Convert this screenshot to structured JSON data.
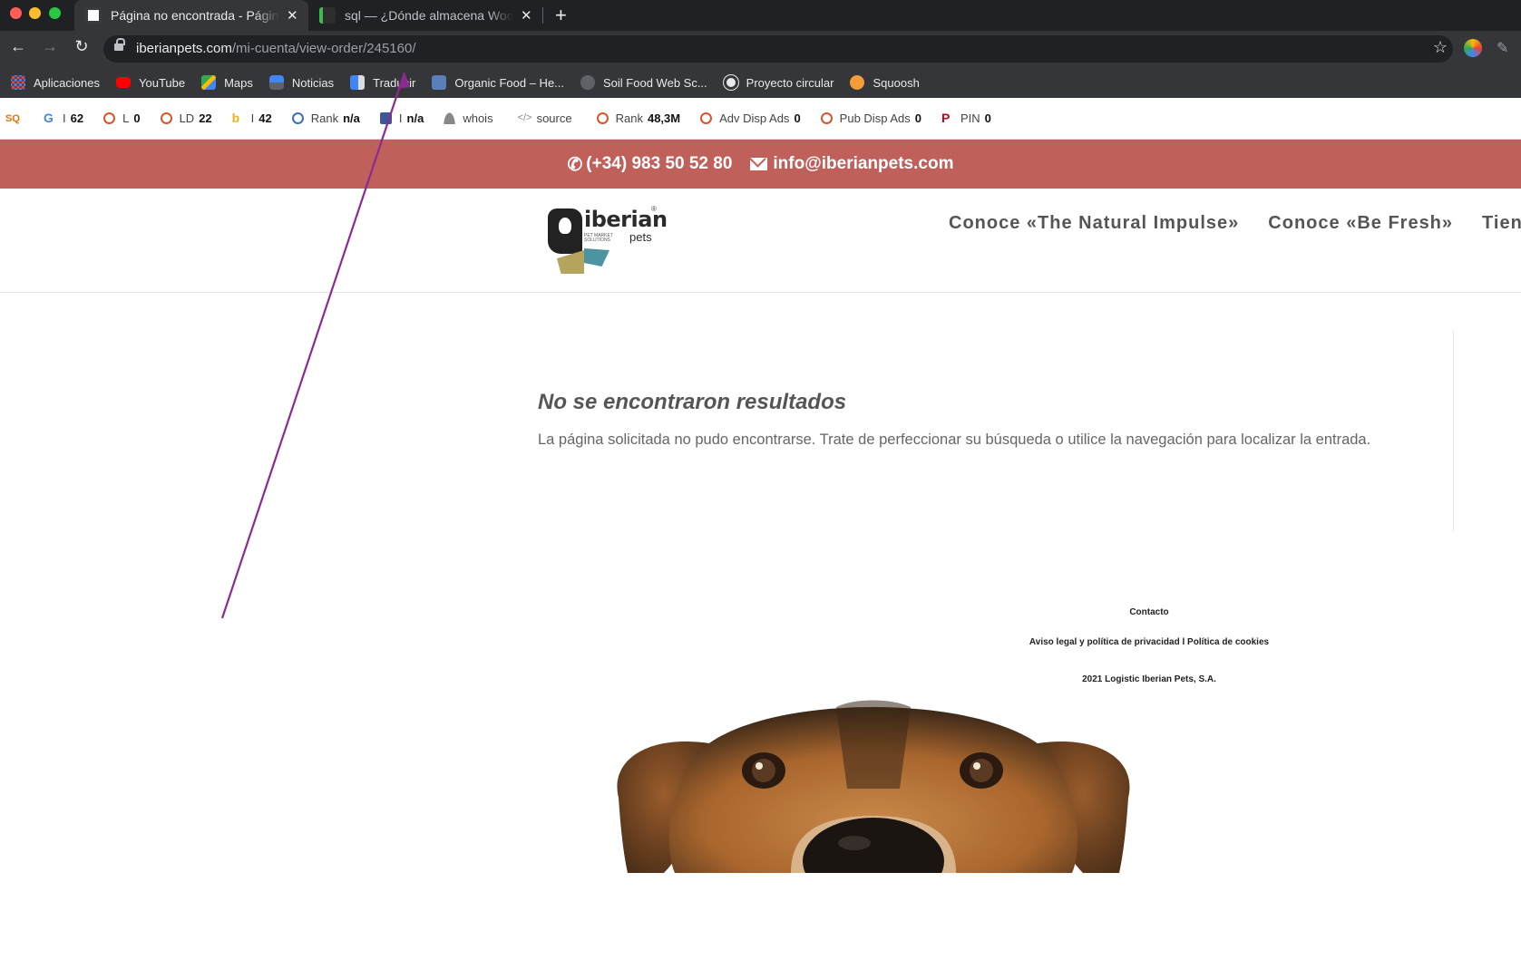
{
  "browser": {
    "tabs": [
      {
        "title": "Página no encontrada - Página",
        "active": true,
        "icon": "iberianpets-favicon"
      },
      {
        "title": "sql — ¿Dónde almacena WooC",
        "active": false,
        "icon": "stackoverflow-favicon"
      }
    ],
    "close_glyph": "✕",
    "newtab_glyph": "+",
    "url_host": "iberianpets.com",
    "url_path": "/mi-cuenta/view-order/245160/",
    "bookmarks": [
      {
        "label": "Aplicaciones",
        "icon": "apps-icon"
      },
      {
        "label": "YouTube",
        "icon": "youtube-icon"
      },
      {
        "label": "Maps",
        "icon": "maps-icon"
      },
      {
        "label": "Noticias",
        "icon": "news-icon"
      },
      {
        "label": "Traducir",
        "icon": "translate-icon"
      },
      {
        "label": "Organic Food – He...",
        "icon": "organic-food-icon"
      },
      {
        "label": "Soil Food Web Sc...",
        "icon": "soil-icon"
      },
      {
        "label": "Proyecto circular",
        "icon": "globe-icon"
      },
      {
        "label": "Squoosh",
        "icon": "squoosh-icon"
      }
    ]
  },
  "seobar": {
    "items": [
      {
        "label": "I",
        "value": "62",
        "icon": "google-icon"
      },
      {
        "label": "L",
        "value": "0",
        "icon": "ring-icon"
      },
      {
        "label": "LD",
        "value": "22",
        "icon": "ring-icon"
      },
      {
        "label": "I",
        "value": "42",
        "icon": "bing-icon"
      },
      {
        "label": "Rank",
        "value": "n/a",
        "icon": "alexa-icon"
      },
      {
        "label": "I",
        "value": "n/a",
        "icon": "facebook-icon"
      },
      {
        "label": "whois",
        "value": "",
        "icon": "person-icon"
      },
      {
        "label": "source",
        "value": "",
        "icon": "code-icon"
      },
      {
        "label": "Rank",
        "value": "48,3M",
        "icon": "ring-icon"
      },
      {
        "label": "Adv Disp Ads",
        "value": "0",
        "icon": "ring-icon"
      },
      {
        "label": "Pub Disp Ads",
        "value": "0",
        "icon": "ring-icon"
      },
      {
        "label": "PIN",
        "value": "0",
        "icon": "pinterest-icon"
      }
    ]
  },
  "site": {
    "phone": "(+34) 983 50 52 80",
    "email": "info@iberianpets.com",
    "logo_word": "iberian",
    "logo_sub": "pets",
    "logo_tag": "PET MARKET SOLUTIONS",
    "logo_reg": "®",
    "nav": [
      "Conoce «The Natural Impulse»",
      "Conoce «Be Fresh»",
      "Tienda"
    ],
    "colors": {
      "topbar": "#c0605b",
      "nav_text": "#555555"
    }
  },
  "main": {
    "title": "No se encontraron resultados",
    "text": "La página solicitada no pudo encontrarse. Trate de perfeccionar su búsqueda o utilice la navegación para localizar la entrada."
  },
  "footer": {
    "contact": "Contacto",
    "legal": "Aviso legal y política de privacidad l Política de cookies",
    "copyright": "2021 Logistic Iberian Pets, S.A."
  }
}
